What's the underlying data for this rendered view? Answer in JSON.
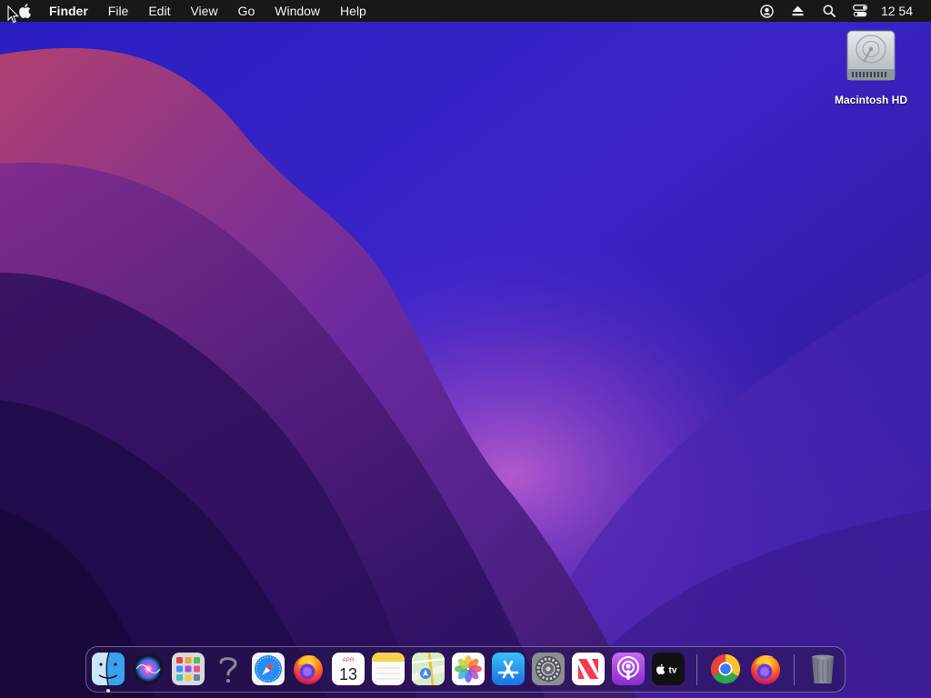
{
  "menubar": {
    "apple_icon": "apple-logo-icon",
    "app_name": "Finder",
    "menus": [
      "File",
      "Edit",
      "View",
      "Go",
      "Window",
      "Help"
    ],
    "status_icons": [
      "user-account-icon",
      "eject-icon",
      "spotlight-search-icon",
      "control-center-icon"
    ],
    "clock": "12 54"
  },
  "desktop": {
    "icons": [
      {
        "label": "Macintosh HD",
        "icon": "hard-drive-icon"
      }
    ]
  },
  "dock": {
    "apps": [
      {
        "icon": "finder-icon",
        "running": true
      },
      {
        "icon": "siri-icon"
      },
      {
        "icon": "launchpad-icon"
      },
      {
        "icon": "question-mark-icon"
      },
      {
        "icon": "safari-icon"
      },
      {
        "icon": "firefox-icon"
      },
      {
        "icon": "calendar-icon",
        "month": "APR",
        "day": "13"
      },
      {
        "icon": "notes-icon"
      },
      {
        "icon": "maps-icon"
      },
      {
        "icon": "photos-icon"
      },
      {
        "icon": "app-store-icon"
      },
      {
        "icon": "system-preferences-icon"
      },
      {
        "icon": "news-icon"
      },
      {
        "icon": "podcasts-icon"
      },
      {
        "icon": "apple-tv-icon",
        "label": "tv"
      },
      {
        "icon": "chrome-icon"
      },
      {
        "icon": "firefox-icon"
      },
      {
        "icon": "trash-icon"
      }
    ]
  },
  "colors": {
    "menubar_bg": "#181818",
    "wallpaper_deep": "#241070",
    "wallpaper_mid": "#4a2ac8",
    "wallpaper_magenta": "#b040c8"
  }
}
